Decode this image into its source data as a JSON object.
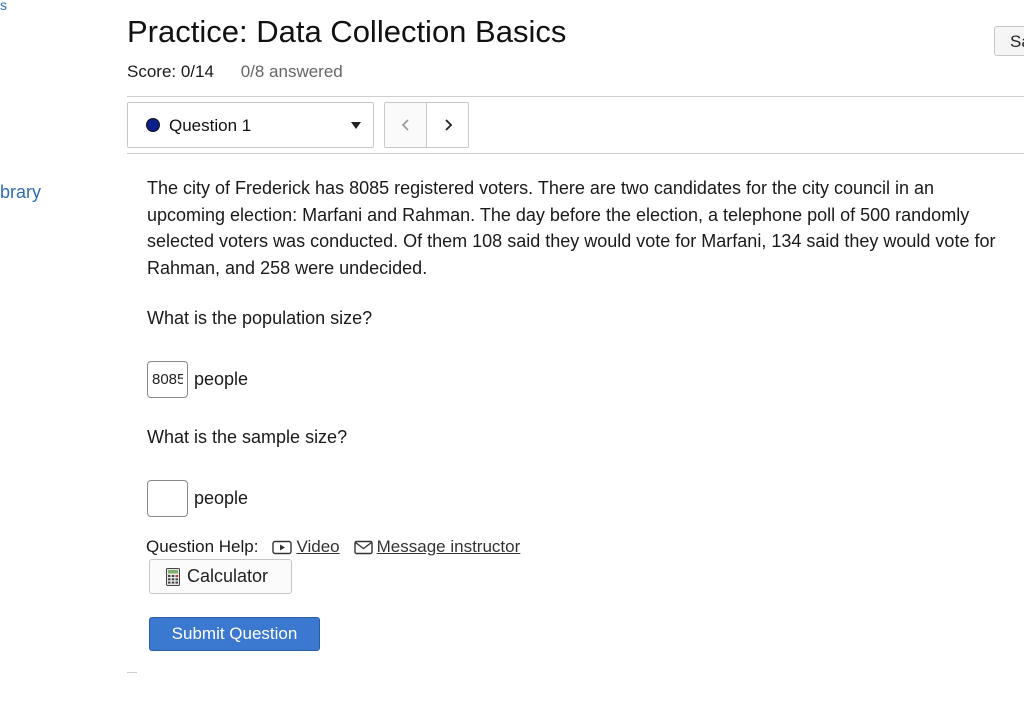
{
  "edge": {
    "top_left_fragment": "s",
    "left_link_fragment": "brary"
  },
  "header": {
    "title": "Practice: Data Collection Basics",
    "save_button_fragment": "Sa",
    "score": "Score: 0/14",
    "answered": "0/8 answered"
  },
  "question_nav": {
    "selected": "Question 1",
    "status_color": "#0b1f8a",
    "prev_icon": "chevron-left-icon",
    "next_icon": "chevron-right-icon"
  },
  "question": {
    "text": "The city of Frederick has 8085 registered voters. There are two candidates for the city council in an upcoming election: Marfani and Rahman. The day before the election, a telephone poll of 500 randomly selected voters was conducted. Of them 108 said they would vote for Marfani, 134 said they would vote for Rahman, and 258 were undecided.",
    "parts": [
      {
        "prompt": "What is the population size?",
        "value": "8085",
        "unit": "people"
      },
      {
        "prompt": "What is the sample size?",
        "value": "",
        "unit": "people"
      }
    ]
  },
  "help": {
    "label": "Question Help:",
    "video": "Video",
    "message": "Message instructor",
    "calculator": "Calculator"
  },
  "submit_label": "Submit Question",
  "colors": {
    "accent": "#3b78cf",
    "link": "#2f6db5"
  }
}
